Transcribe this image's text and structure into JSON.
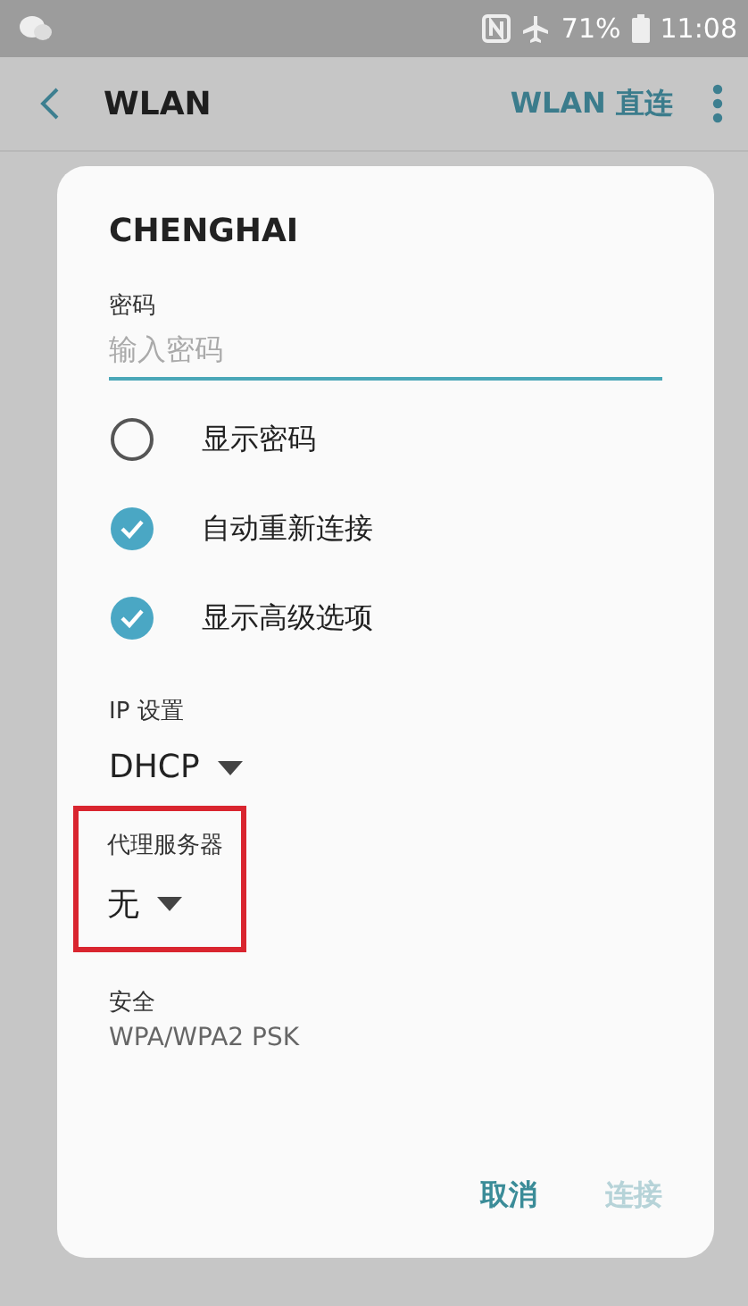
{
  "status_bar": {
    "battery": "71%",
    "time": "11:08"
  },
  "app_bar": {
    "title": "WLAN",
    "action": "WLAN 直连"
  },
  "dialog": {
    "title": "CHENGHAI",
    "password": {
      "label": "密码",
      "placeholder": "输入密码"
    },
    "options": [
      {
        "label": "显示密码",
        "checked": false
      },
      {
        "label": "自动重新连接",
        "checked": true
      },
      {
        "label": "显示高级选项",
        "checked": true
      }
    ],
    "dropdowns": [
      {
        "label": "IP 设置",
        "value": "DHCP",
        "highlighted": false
      },
      {
        "label": "代理服务器",
        "value": "无",
        "highlighted": true
      }
    ],
    "security": {
      "label": "安全",
      "value": "WPA/WPA2 PSK"
    },
    "buttons": [
      {
        "label": "取消",
        "disabled": false
      },
      {
        "label": "连接",
        "disabled": true
      }
    ]
  }
}
